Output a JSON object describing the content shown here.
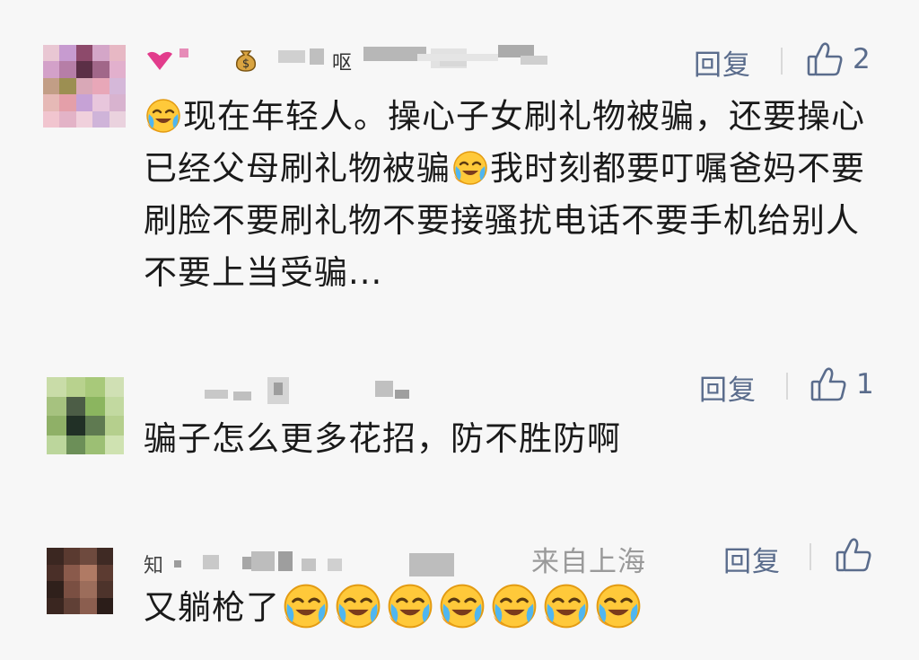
{
  "comments": [
    {
      "author": "呕",
      "text_parts": [
        "现在年轻人。操心子女刷礼物被骗，还要操心已经父母刷礼物被骗",
        "我时刻都要叮嘱爸妈不要刷脸不要刷礼物不要接骚扰电话不要手机给别人不要上当受骗..."
      ],
      "reply_label": "回复",
      "like_count": "2"
    },
    {
      "text": "骗子怎么更多花招，防不胜防啊",
      "reply_label": "回复",
      "like_count": "1"
    },
    {
      "author": "知",
      "location": "来自上海",
      "text": "又躺枪了",
      "emoji_count": 7,
      "reply_label": "回复"
    }
  ],
  "icons": {
    "emoji": "crying-laughing-emoji",
    "like": "thumbs-up-icon",
    "money_bag": "money-bag-emoji",
    "heart": "heart-icon"
  },
  "colors": {
    "background": "#f7f7f7",
    "text": "#1a1a1a",
    "action": "#5a6c8c",
    "location": "#9a9a9a",
    "emoji_face": "#ffc93a"
  }
}
